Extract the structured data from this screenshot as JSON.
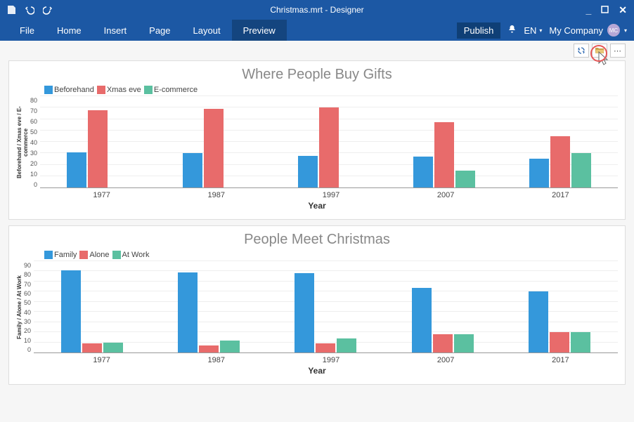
{
  "window": {
    "title": "Christmas.mrt - Designer"
  },
  "menu": {
    "items": [
      "File",
      "Home",
      "Insert",
      "Page",
      "Layout",
      "Preview"
    ],
    "active_index": 5,
    "publish": "Publish",
    "language": "EN",
    "company": "My Company",
    "avatar_initials": "MC"
  },
  "colors": {
    "blue": "#3498db",
    "red": "#e86b6b",
    "teal": "#5bc0a0"
  },
  "chart_data": [
    {
      "type": "bar",
      "title": "Where People Buy Gifts",
      "xlabel": "Year",
      "ylabel": "Beforehand / Xmas eve / E-commerce",
      "categories": [
        "1977",
        "1987",
        "1997",
        "2007",
        "2017"
      ],
      "ylim": [
        0,
        80
      ],
      "yticks": [
        0,
        10,
        20,
        30,
        40,
        50,
        60,
        70,
        80
      ],
      "series": [
        {
          "name": "Beforehand",
          "color": "blue",
          "values": [
            31,
            30,
            28,
            27,
            25
          ]
        },
        {
          "name": "Xmas eve",
          "color": "red",
          "values": [
            68,
            69,
            70,
            57,
            45
          ]
        },
        {
          "name": "E-commerce",
          "color": "teal",
          "values": [
            0,
            0,
            0,
            15,
            30
          ]
        }
      ]
    },
    {
      "type": "bar",
      "title": "People Meet Christmas",
      "xlabel": "Year",
      "ylabel": "Family / Alone / At Work",
      "categories": [
        "1977",
        "1987",
        "1997",
        "2007",
        "2017"
      ],
      "ylim": [
        0,
        90
      ],
      "yticks": [
        0,
        10,
        20,
        30,
        40,
        50,
        60,
        70,
        80,
        90
      ],
      "series": [
        {
          "name": "Family",
          "color": "blue",
          "values": [
            81,
            79,
            78,
            64,
            60
          ]
        },
        {
          "name": "Alone",
          "color": "red",
          "values": [
            9,
            7,
            9,
            18,
            20
          ]
        },
        {
          "name": "At Work",
          "color": "teal",
          "values": [
            10,
            12,
            14,
            18,
            20
          ]
        }
      ]
    }
  ]
}
